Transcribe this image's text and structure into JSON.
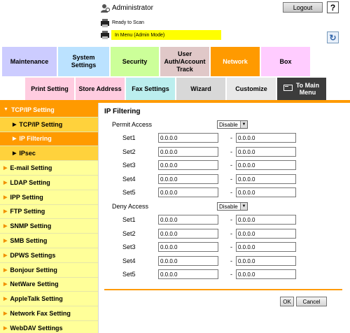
{
  "header": {
    "admin_label": "Administrator",
    "logout_label": "Logout",
    "help_label": "?",
    "status_text": "Ready to Scan",
    "mode_text": "In Menu (Admin Mode)"
  },
  "main_tabs": [
    {
      "label": "Maintenance",
      "color": "#ccccff"
    },
    {
      "label": "System Settings",
      "color": "#bbe2ff"
    },
    {
      "label": "Security",
      "color": "#ccff99"
    },
    {
      "label": "User Auth/Account Track",
      "color": "#e0c8c8"
    },
    {
      "label": "Network",
      "color": "#ff9a00"
    },
    {
      "label": "Box",
      "color": "#ffccff"
    }
  ],
  "sub_tabs": [
    {
      "label": "Print Setting",
      "color": "#ffcce0"
    },
    {
      "label": "Store Address",
      "color": "#ffcce0"
    },
    {
      "label": "Fax Settings",
      "color": "#bbeeee"
    },
    {
      "label": "Wizard",
      "color": "#d8d8d8"
    },
    {
      "label": "Customize",
      "color": "#e8e8e8"
    },
    {
      "label": "To Main Menu",
      "color": "#3c3c3c"
    }
  ],
  "sidebar": {
    "items": [
      {
        "label": "TCP/IP Setting"
      },
      {
        "label": "TCP/IP Setting"
      },
      {
        "label": "IP Filtering"
      },
      {
        "label": "IPsec"
      },
      {
        "label": "E-mail Setting"
      },
      {
        "label": "LDAP Setting"
      },
      {
        "label": "IPP Setting"
      },
      {
        "label": "FTP Setting"
      },
      {
        "label": "SNMP Setting"
      },
      {
        "label": "SMB Setting"
      },
      {
        "label": "DPWS Settings"
      },
      {
        "label": "Bonjour Setting"
      },
      {
        "label": "NetWare Setting"
      },
      {
        "label": "AppleTalk Setting"
      },
      {
        "label": "Network Fax Setting"
      },
      {
        "label": "WebDAV Settings"
      }
    ]
  },
  "content": {
    "title": "IP Filtering",
    "permit": {
      "label": "Permit Access",
      "value": "Disable",
      "sets": [
        {
          "label": "Set1",
          "from": "0.0.0.0",
          "to": "0.0.0.0"
        },
        {
          "label": "Set2",
          "from": "0.0.0.0",
          "to": "0.0.0.0"
        },
        {
          "label": "Set3",
          "from": "0.0.0.0",
          "to": "0.0.0.0"
        },
        {
          "label": "Set4",
          "from": "0.0.0.0",
          "to": "0.0.0.0"
        },
        {
          "label": "Set5",
          "from": "0.0.0.0",
          "to": "0.0.0.0"
        }
      ]
    },
    "deny": {
      "label": "Deny Access",
      "value": "Disable",
      "sets": [
        {
          "label": "Set1",
          "from": "0.0.0.0",
          "to": "0.0.0.0"
        },
        {
          "label": "Set2",
          "from": "0.0.0.0",
          "to": "0.0.0.0"
        },
        {
          "label": "Set3",
          "from": "0.0.0.0",
          "to": "0.0.0.0"
        },
        {
          "label": "Set4",
          "from": "0.0.0.0",
          "to": "0.0.0.0"
        },
        {
          "label": "Set5",
          "from": "0.0.0.0",
          "to": "0.0.0.0"
        }
      ]
    },
    "dash": "-",
    "ok_label": "OK",
    "cancel_label": "Cancel"
  }
}
